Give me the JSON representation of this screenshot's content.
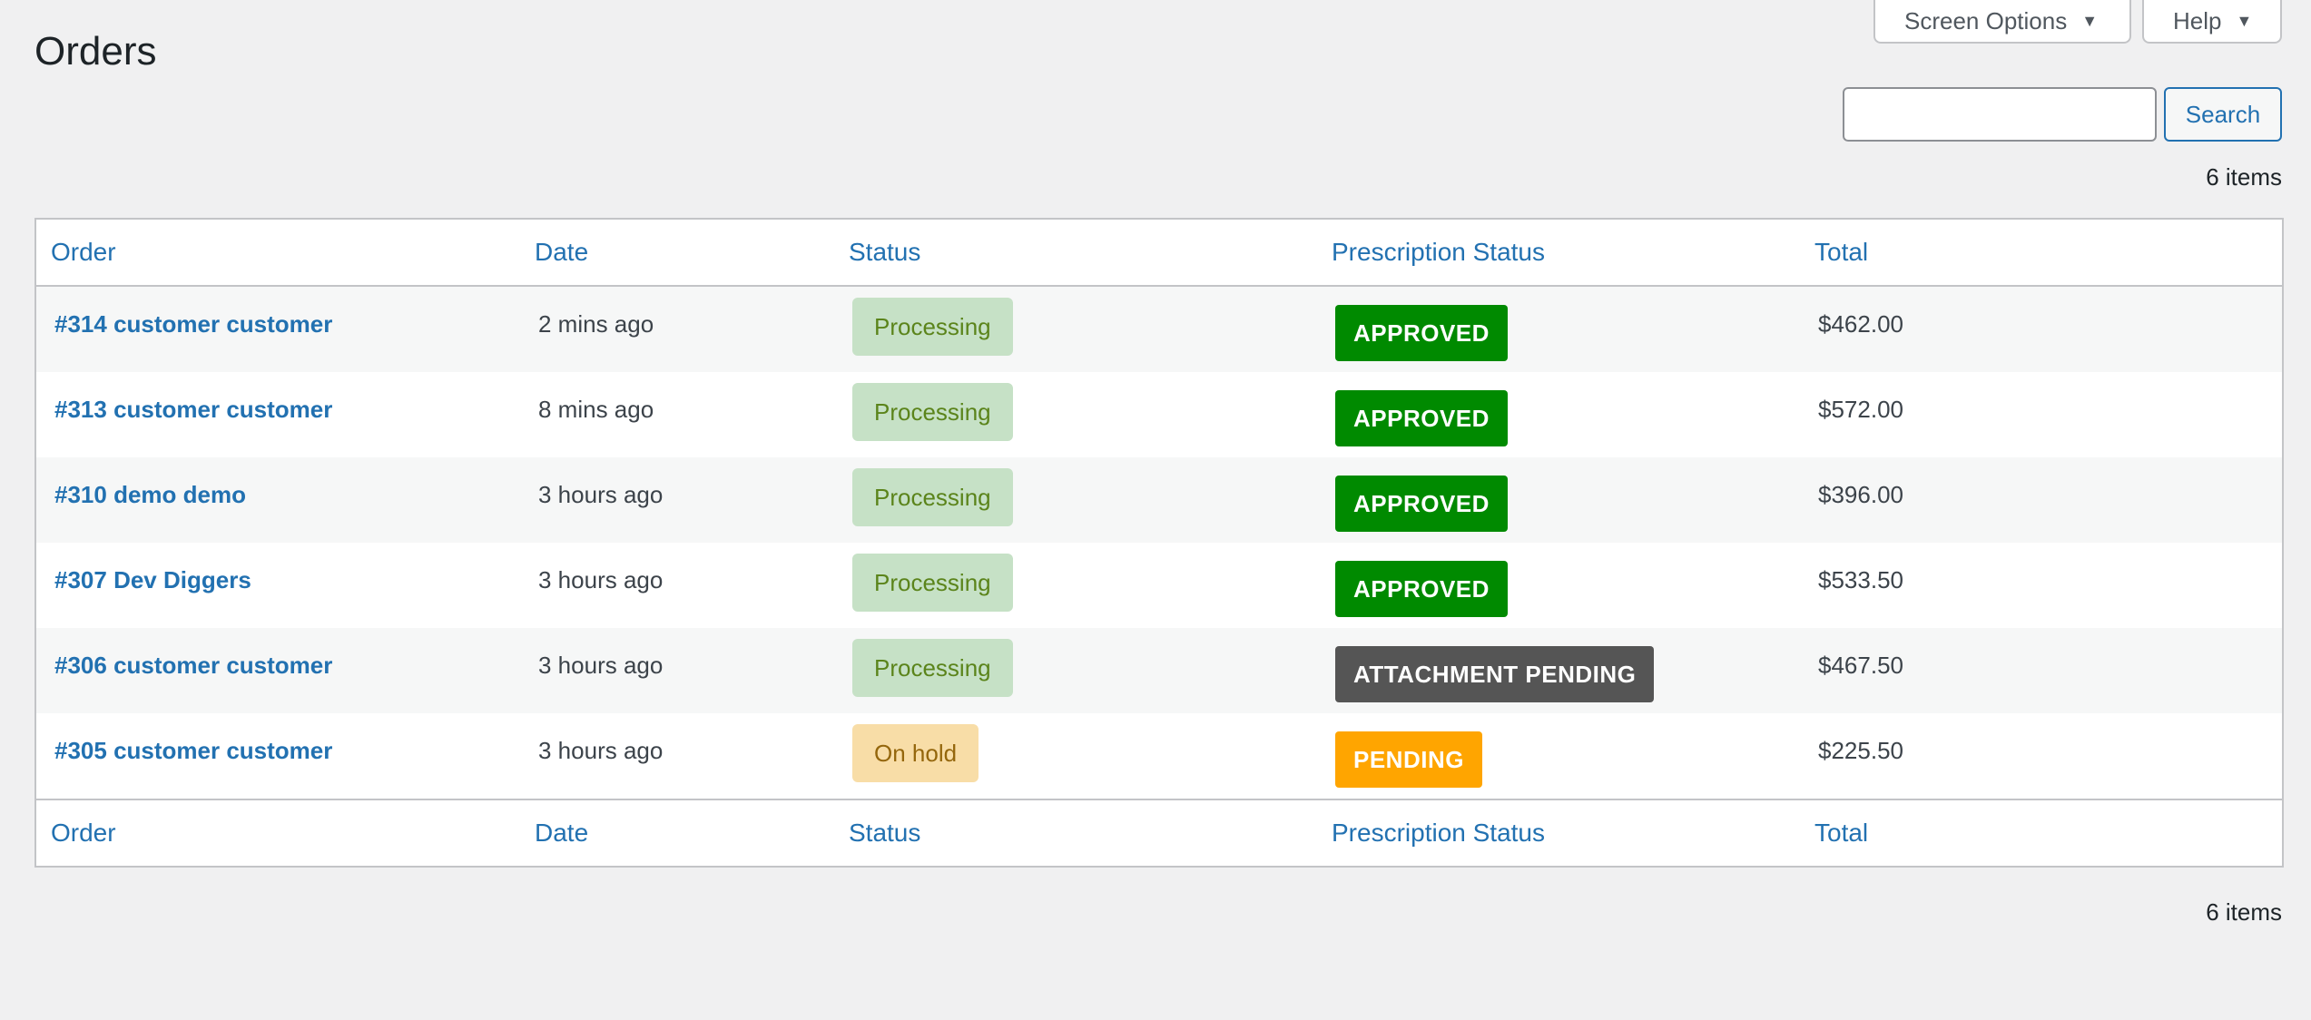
{
  "header": {
    "screen_options_label": "Screen Options",
    "help_label": "Help",
    "title": "Orders"
  },
  "search": {
    "value": "",
    "placeholder": "",
    "button_label": "Search"
  },
  "pagination": {
    "items_count": "6 items"
  },
  "table": {
    "columns": [
      "Order",
      "Date",
      "Status",
      "Prescription Status",
      "Total"
    ],
    "rows": [
      {
        "order": "#314 customer customer",
        "date": "2 mins ago",
        "status": "Processing",
        "prescription_status": "APPROVED",
        "total": "$462.00"
      },
      {
        "order": "#313 customer customer",
        "date": "8 mins ago",
        "status": "Processing",
        "prescription_status": "APPROVED",
        "total": "$572.00"
      },
      {
        "order": "#310 demo demo",
        "date": "3 hours ago",
        "status": "Processing",
        "prescription_status": "APPROVED",
        "total": "$396.00"
      },
      {
        "order": "#307 Dev Diggers",
        "date": "3 hours ago",
        "status": "Processing",
        "prescription_status": "APPROVED",
        "total": "$533.50"
      },
      {
        "order": "#306 customer customer",
        "date": "3 hours ago",
        "status": "Processing",
        "prescription_status": "ATTACHMENT PENDING",
        "total": "$467.50"
      },
      {
        "order": "#305 customer customer",
        "date": "3 hours ago",
        "status": "On hold",
        "prescription_status": "PENDING",
        "total": "$225.50"
      }
    ]
  },
  "colors": {
    "link": "#2271b1",
    "approved": "#008a00",
    "attachment_pending": "#555555",
    "pending": "#ffa500",
    "processing_bg": "#c6e1c6",
    "on_hold_bg": "#f8dda7"
  },
  "icons": {
    "dropdown": "caret-down-icon"
  }
}
